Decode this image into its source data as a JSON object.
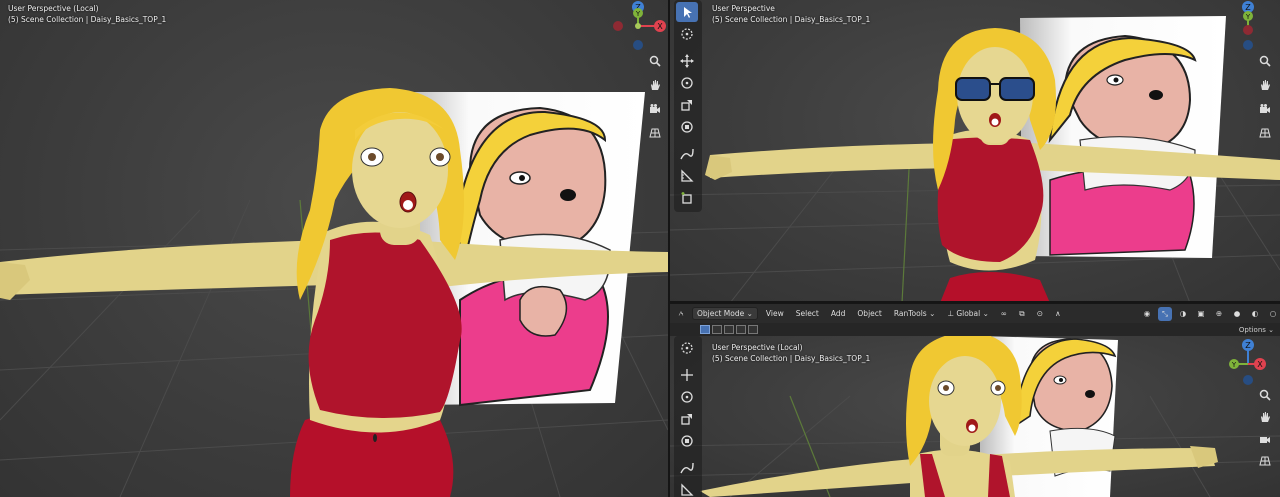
{
  "viewports": {
    "left": {
      "perspective": "User Perspective (Local)",
      "collection": "(5) Scene Collection | Daisy_Basics_TOP_1"
    },
    "top_right": {
      "perspective": "User Perspective",
      "collection": "(5) Scene Collection | Daisy_Basics_TOP_1"
    },
    "bottom_right": {
      "perspective": "User Perspective (Local)",
      "collection": "(5) Scene Collection | Daisy_Basics_TOP_1"
    }
  },
  "gizmo_labels": {
    "z": "Z",
    "y": "Y",
    "x": "X"
  },
  "header": {
    "mode": "Object Mode",
    "menus": [
      "View",
      "Select",
      "Add",
      "Object",
      "RanTools"
    ],
    "orientation": "Global",
    "options": "Options"
  },
  "colors": {
    "accent": "#4772b3",
    "axis_x": "#e0424f",
    "axis_y": "#7fb33a",
    "axis_z": "#3f80d4",
    "skin": "#e8d98f",
    "hair": "#f0c832",
    "top": "#b0142c"
  },
  "icons": {
    "nav": [
      "zoom-icon",
      "hand-pan-icon",
      "camera-icon",
      "grid-view-icon"
    ],
    "tools": [
      "select-box-icon",
      "cursor-icon",
      "move-icon",
      "rotate-icon",
      "scale-icon",
      "transform-icon",
      "annotate-icon",
      "measure-icon",
      "add-cube-icon"
    ]
  }
}
